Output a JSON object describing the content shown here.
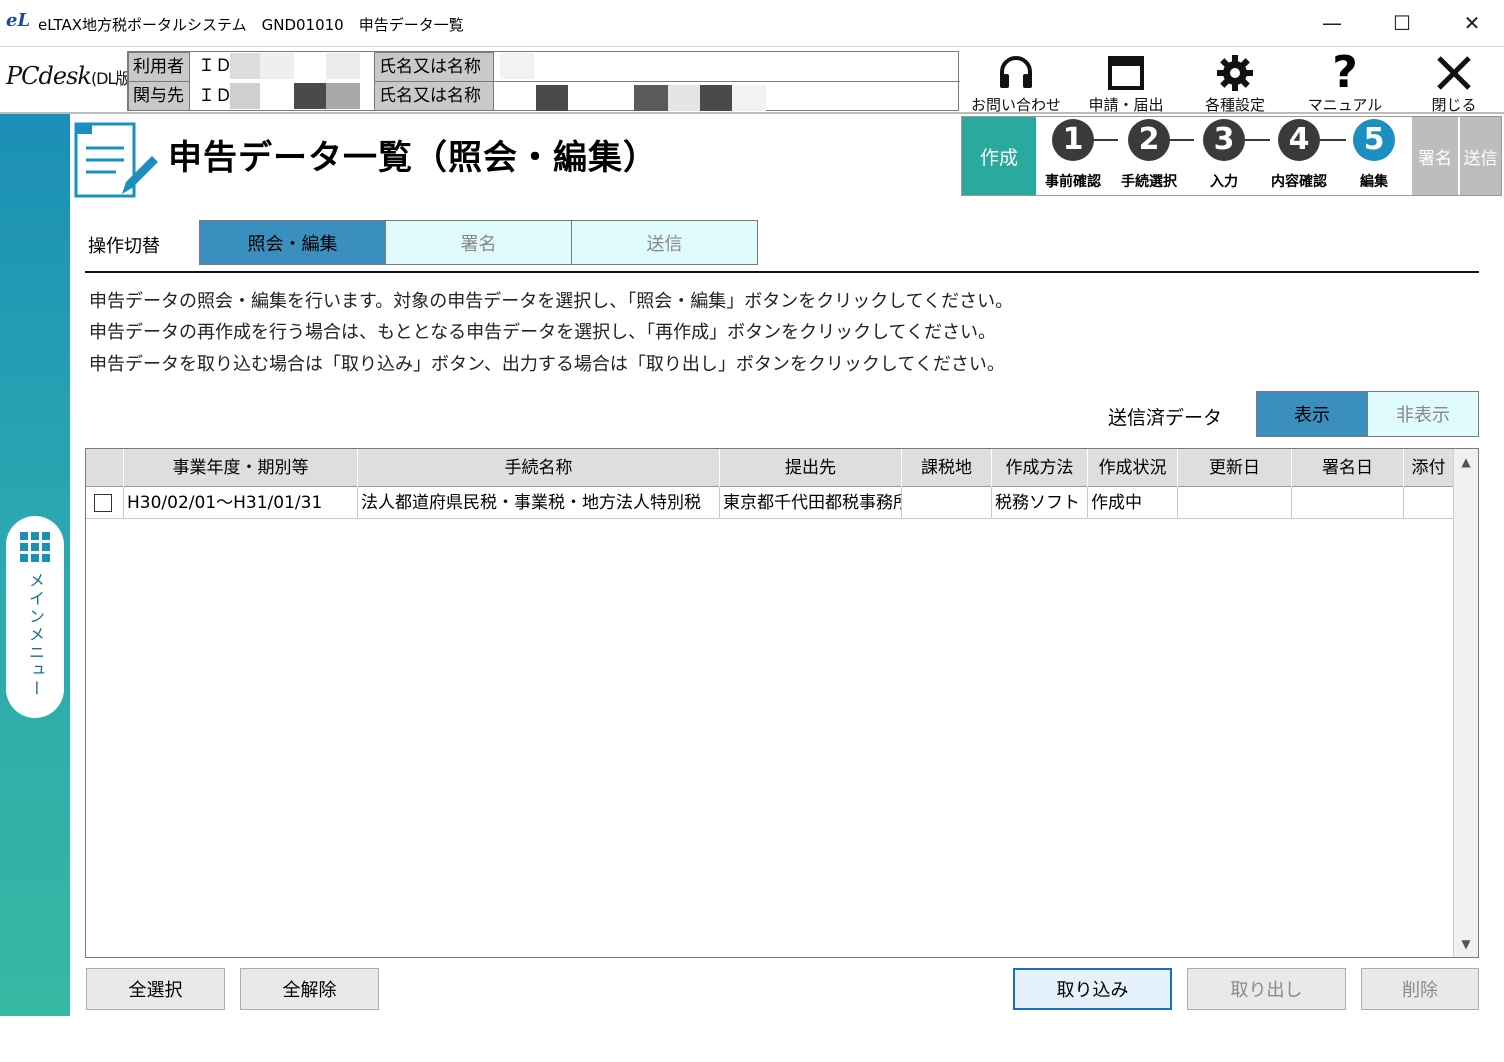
{
  "window": {
    "title": "eLTAX地方税ポータルシステム　GND01010　申告データ一覧",
    "logo_text": "eL",
    "minimize": "—",
    "maximize": "☐",
    "close": "✕"
  },
  "header": {
    "pcdesk": "PCdesk",
    "pcdesk_edition": "(DL版)",
    "user_label": "利用者",
    "related_label": "関与先",
    "id_label": "ＩＤ",
    "name_label": "氏名又は名称",
    "buttons": [
      {
        "label": "お問い合わせ",
        "icon": "headset-icon"
      },
      {
        "label": "申請・届出",
        "icon": "window-icon"
      },
      {
        "label": "各種設定",
        "icon": "gear-icon"
      },
      {
        "label": "マニュアル",
        "icon": "question-icon"
      },
      {
        "label": "閉じる",
        "icon": "close-icon"
      }
    ]
  },
  "sidebar": {
    "menu_label": "メインメニュー"
  },
  "page": {
    "title": "申告データ一覧（照会・編集）"
  },
  "steps": {
    "create": "作成",
    "items": [
      {
        "num": "1",
        "label": "事前確認"
      },
      {
        "num": "2",
        "label": "手続選択"
      },
      {
        "num": "3",
        "label": "入力"
      },
      {
        "num": "4",
        "label": "内容確認"
      },
      {
        "num": "5",
        "label": "編集"
      }
    ],
    "sign": "署名",
    "send": "送信"
  },
  "operation": {
    "label": "操作切替",
    "tabs": [
      "照会・編集",
      "署名",
      "送信"
    ]
  },
  "description": [
    "申告データの照会・編集を行います。対象の申告データを選択し、「照会・編集」ボタンをクリックしてください。",
    "申告データの再作成を行う場合は、もととなる申告データを選択し、「再作成」ボタンをクリックしてください。",
    "申告データを取り込む場合は「取り込み」ボタン、出力する場合は「取り出し」ボタンをクリックしてください。"
  ],
  "sent_data": {
    "label": "送信済データ",
    "show": "表示",
    "hide": "非表示"
  },
  "table": {
    "columns": [
      "事業年度・期別等",
      "手続名称",
      "提出先",
      "課税地",
      "作成方法",
      "作成状況",
      "更新日",
      "署名日",
      "添付"
    ],
    "rows": [
      {
        "period": "H30/02/01～H31/01/31",
        "procedure": "法人都道府県民税・事業税・地方法人特別税",
        "destination": "東京都千代田都税事務所",
        "tax_place": "",
        "method": "税務ソフト",
        "status": "作成中",
        "updated": "",
        "signed": "",
        "attach": ""
      }
    ]
  },
  "buttons": {
    "select_all": "全選択",
    "deselect_all": "全解除",
    "import": "取り込み",
    "export": "取り出し",
    "delete": "削除"
  },
  "colors": {
    "accent": "#3a8fbf",
    "step_active": "#1a8fc0",
    "create_tab": "#2aa99e",
    "toggle_inactive": "#e0fbfd"
  }
}
